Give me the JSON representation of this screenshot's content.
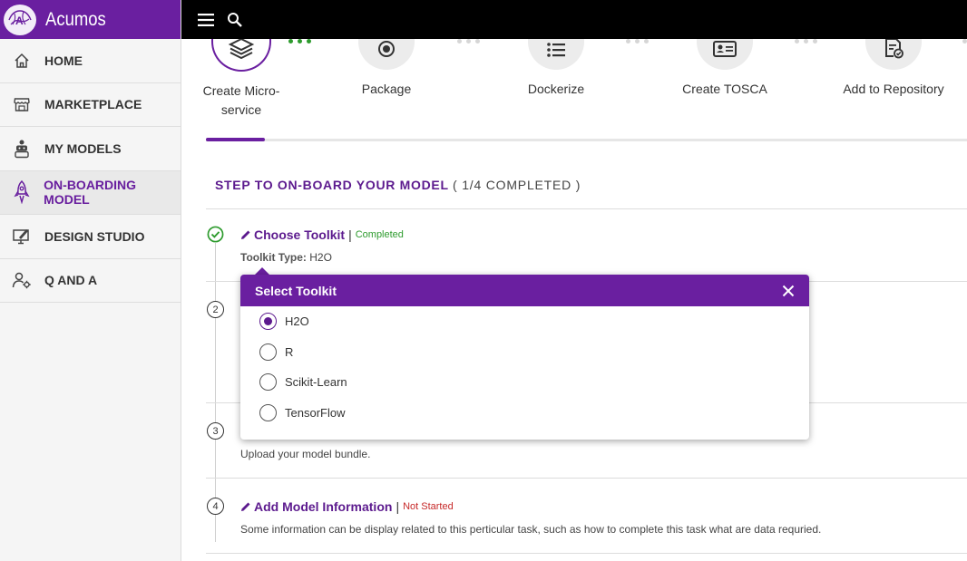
{
  "brand": {
    "name": "Acumos"
  },
  "sidebar": {
    "items": [
      {
        "label": "HOME",
        "icon": "home-icon",
        "active": false
      },
      {
        "label": "MARKETPLACE",
        "icon": "store-icon",
        "active": false
      },
      {
        "label": "MY MODELS",
        "icon": "robot-icon",
        "active": false
      },
      {
        "label": "ON-BOARDING MODEL",
        "icon": "rocket-icon",
        "active": true
      },
      {
        "label": "DESIGN STUDIO",
        "icon": "monitor-pencil-icon",
        "active": false
      },
      {
        "label": "Q AND A",
        "icon": "user-gear-icon",
        "active": false
      }
    ]
  },
  "topbar": {
    "menu_icon": "hamburger-icon",
    "search_icon": "search-icon"
  },
  "stepper": {
    "steps": [
      {
        "label": "Create Micro-service",
        "icon": "layers-icon"
      },
      {
        "label": "Package",
        "icon": "target-icon"
      },
      {
        "label": "Dockerize",
        "icon": "list-icon"
      },
      {
        "label": "Create TOSCA",
        "icon": "id-card-icon"
      },
      {
        "label": "Add to Repository",
        "icon": "document-check-icon"
      }
    ],
    "progress_fraction": 0.077
  },
  "onboard": {
    "title": "STEP TO ON-BOARD YOUR MODEL",
    "count": "( 1/4 COMPLETED )",
    "tasks": [
      {
        "num": "1",
        "title": "Choose Toolkit",
        "sep": "|",
        "status": "Completed",
        "detail_label": "Toolkit Type:",
        "detail_value": " H2O"
      },
      {
        "num": "2"
      },
      {
        "num": "3",
        "text": "Upload your model bundle."
      },
      {
        "num": "4",
        "title": "Add Model Information",
        "sep": "|",
        "status": "Not Started",
        "text": "Some information can be display related to this perticular task, such as how to complete this task what are data requried."
      }
    ]
  },
  "modal": {
    "title": "Select Toolkit",
    "options": [
      {
        "label": "H2O",
        "selected": true
      },
      {
        "label": "R",
        "selected": false
      },
      {
        "label": "Scikit-Learn",
        "selected": false
      },
      {
        "label": "TensorFlow",
        "selected": false
      }
    ]
  },
  "colors": {
    "brand": "#6a1fa0",
    "accent_text": "#5c1a8e",
    "completed": "#2e9b2e",
    "not_started": "#c62828"
  }
}
